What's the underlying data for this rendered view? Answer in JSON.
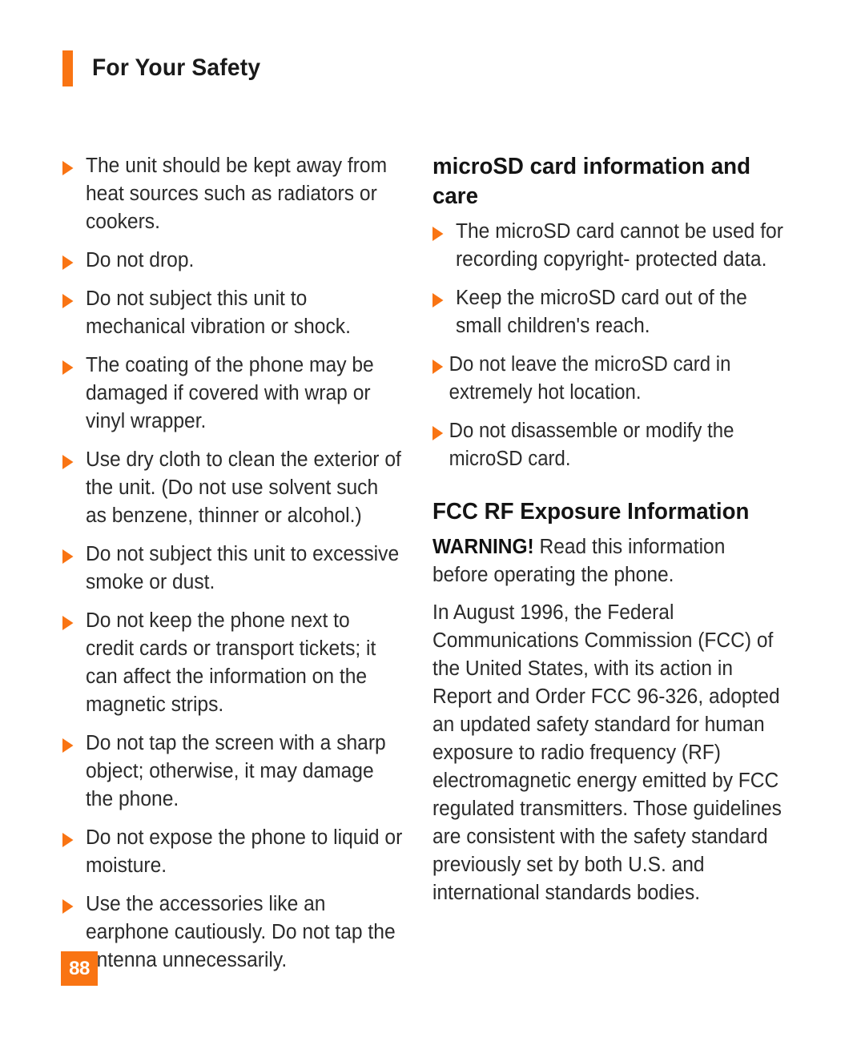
{
  "header": {
    "title": "For Your Safety",
    "marker_color": "#f97413"
  },
  "colors": {
    "accent_orange": "#f97413",
    "body_text": "#2b2b2b",
    "heading_text": "#141414",
    "page_background": "#ffffff",
    "page_number_text": "#ffffff"
  },
  "left_column": {
    "bullets": [
      "The unit should be kept away from heat sources such as radiators or cookers.",
      "Do not drop.",
      "Do not subject this unit to mechanical vibration or shock.",
      "The coating of the phone may be damaged if covered with wrap or vinyl wrapper.",
      "Use dry cloth to clean the exterior of the unit. (Do not use solvent such as benzene, thinner or alcohol.)",
      "Do not subject this unit to excessive smoke or dust.",
      "Do not keep the phone next to credit cards or transport tickets; it can affect the information on the magnetic strips.",
      "Do not tap the screen with a sharp object; otherwise, it may damage the phone.",
      "Do not expose the phone to liquid or moisture.",
      "Use the accessories like an earphone cautiously. Do not tap the antenna unnecessarily."
    ]
  },
  "right_column": {
    "microsd_section": {
      "heading": "microSD card information and care",
      "bullets": [
        "The microSD card cannot be used for recording copyright- protected data.",
        "Keep the microSD card out of the small children's reach.",
        "Do not leave the microSD card in extremely hot location.",
        "Do not disassemble or modify the microSD card."
      ]
    },
    "fcc_section": {
      "heading": "FCC RF Exposure Information",
      "warning_label": "WARNING!",
      "warning_text": " Read this information before operating the phone.",
      "paragraph": "In August 1996, the Federal Communications Commission (FCC) of the United States, with its action in Report and Order FCC 96-326, adopted an updated safety standard for human exposure to radio frequency (RF) electromagnetic energy emitted by FCC regulated transmitters. Those guidelines are consistent with the safety standard previously set by both U.S. and international standards bodies."
    }
  },
  "footer": {
    "page_number": "88"
  }
}
